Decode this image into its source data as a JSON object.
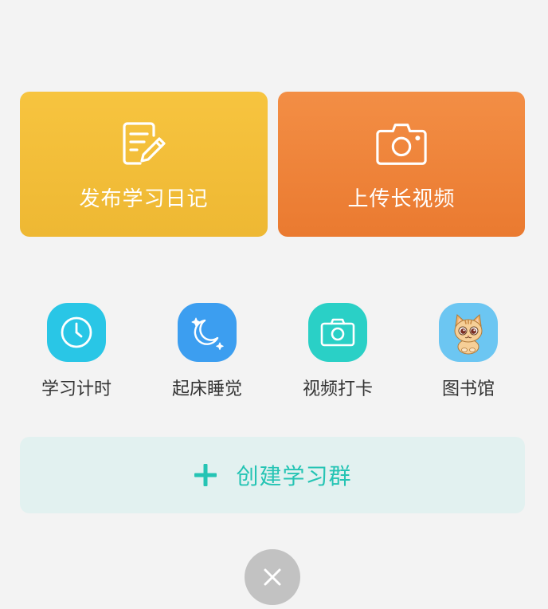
{
  "cards": [
    {
      "label": "发布学习日记",
      "icon": "edit-note-icon",
      "color": "#f4bf3a"
    },
    {
      "label": "上传长视频",
      "icon": "camera-icon",
      "color": "#ef8438"
    }
  ],
  "quick_actions": [
    {
      "label": "学习计时",
      "icon": "clock-icon",
      "color": "#29c6e6"
    },
    {
      "label": "起床睡觉",
      "icon": "moon-stars-icon",
      "color": "#3c9ef0"
    },
    {
      "label": "视频打卡",
      "icon": "camera-icon",
      "color": "#2ad0c6"
    },
    {
      "label": "图书馆",
      "icon": "cat-avatar-icon",
      "color": "#6cc6f2"
    }
  ],
  "create_group": {
    "label": "创建学习群",
    "icon": "plus-icon",
    "color": "#25c4b4"
  },
  "close": {
    "icon": "close-icon"
  }
}
